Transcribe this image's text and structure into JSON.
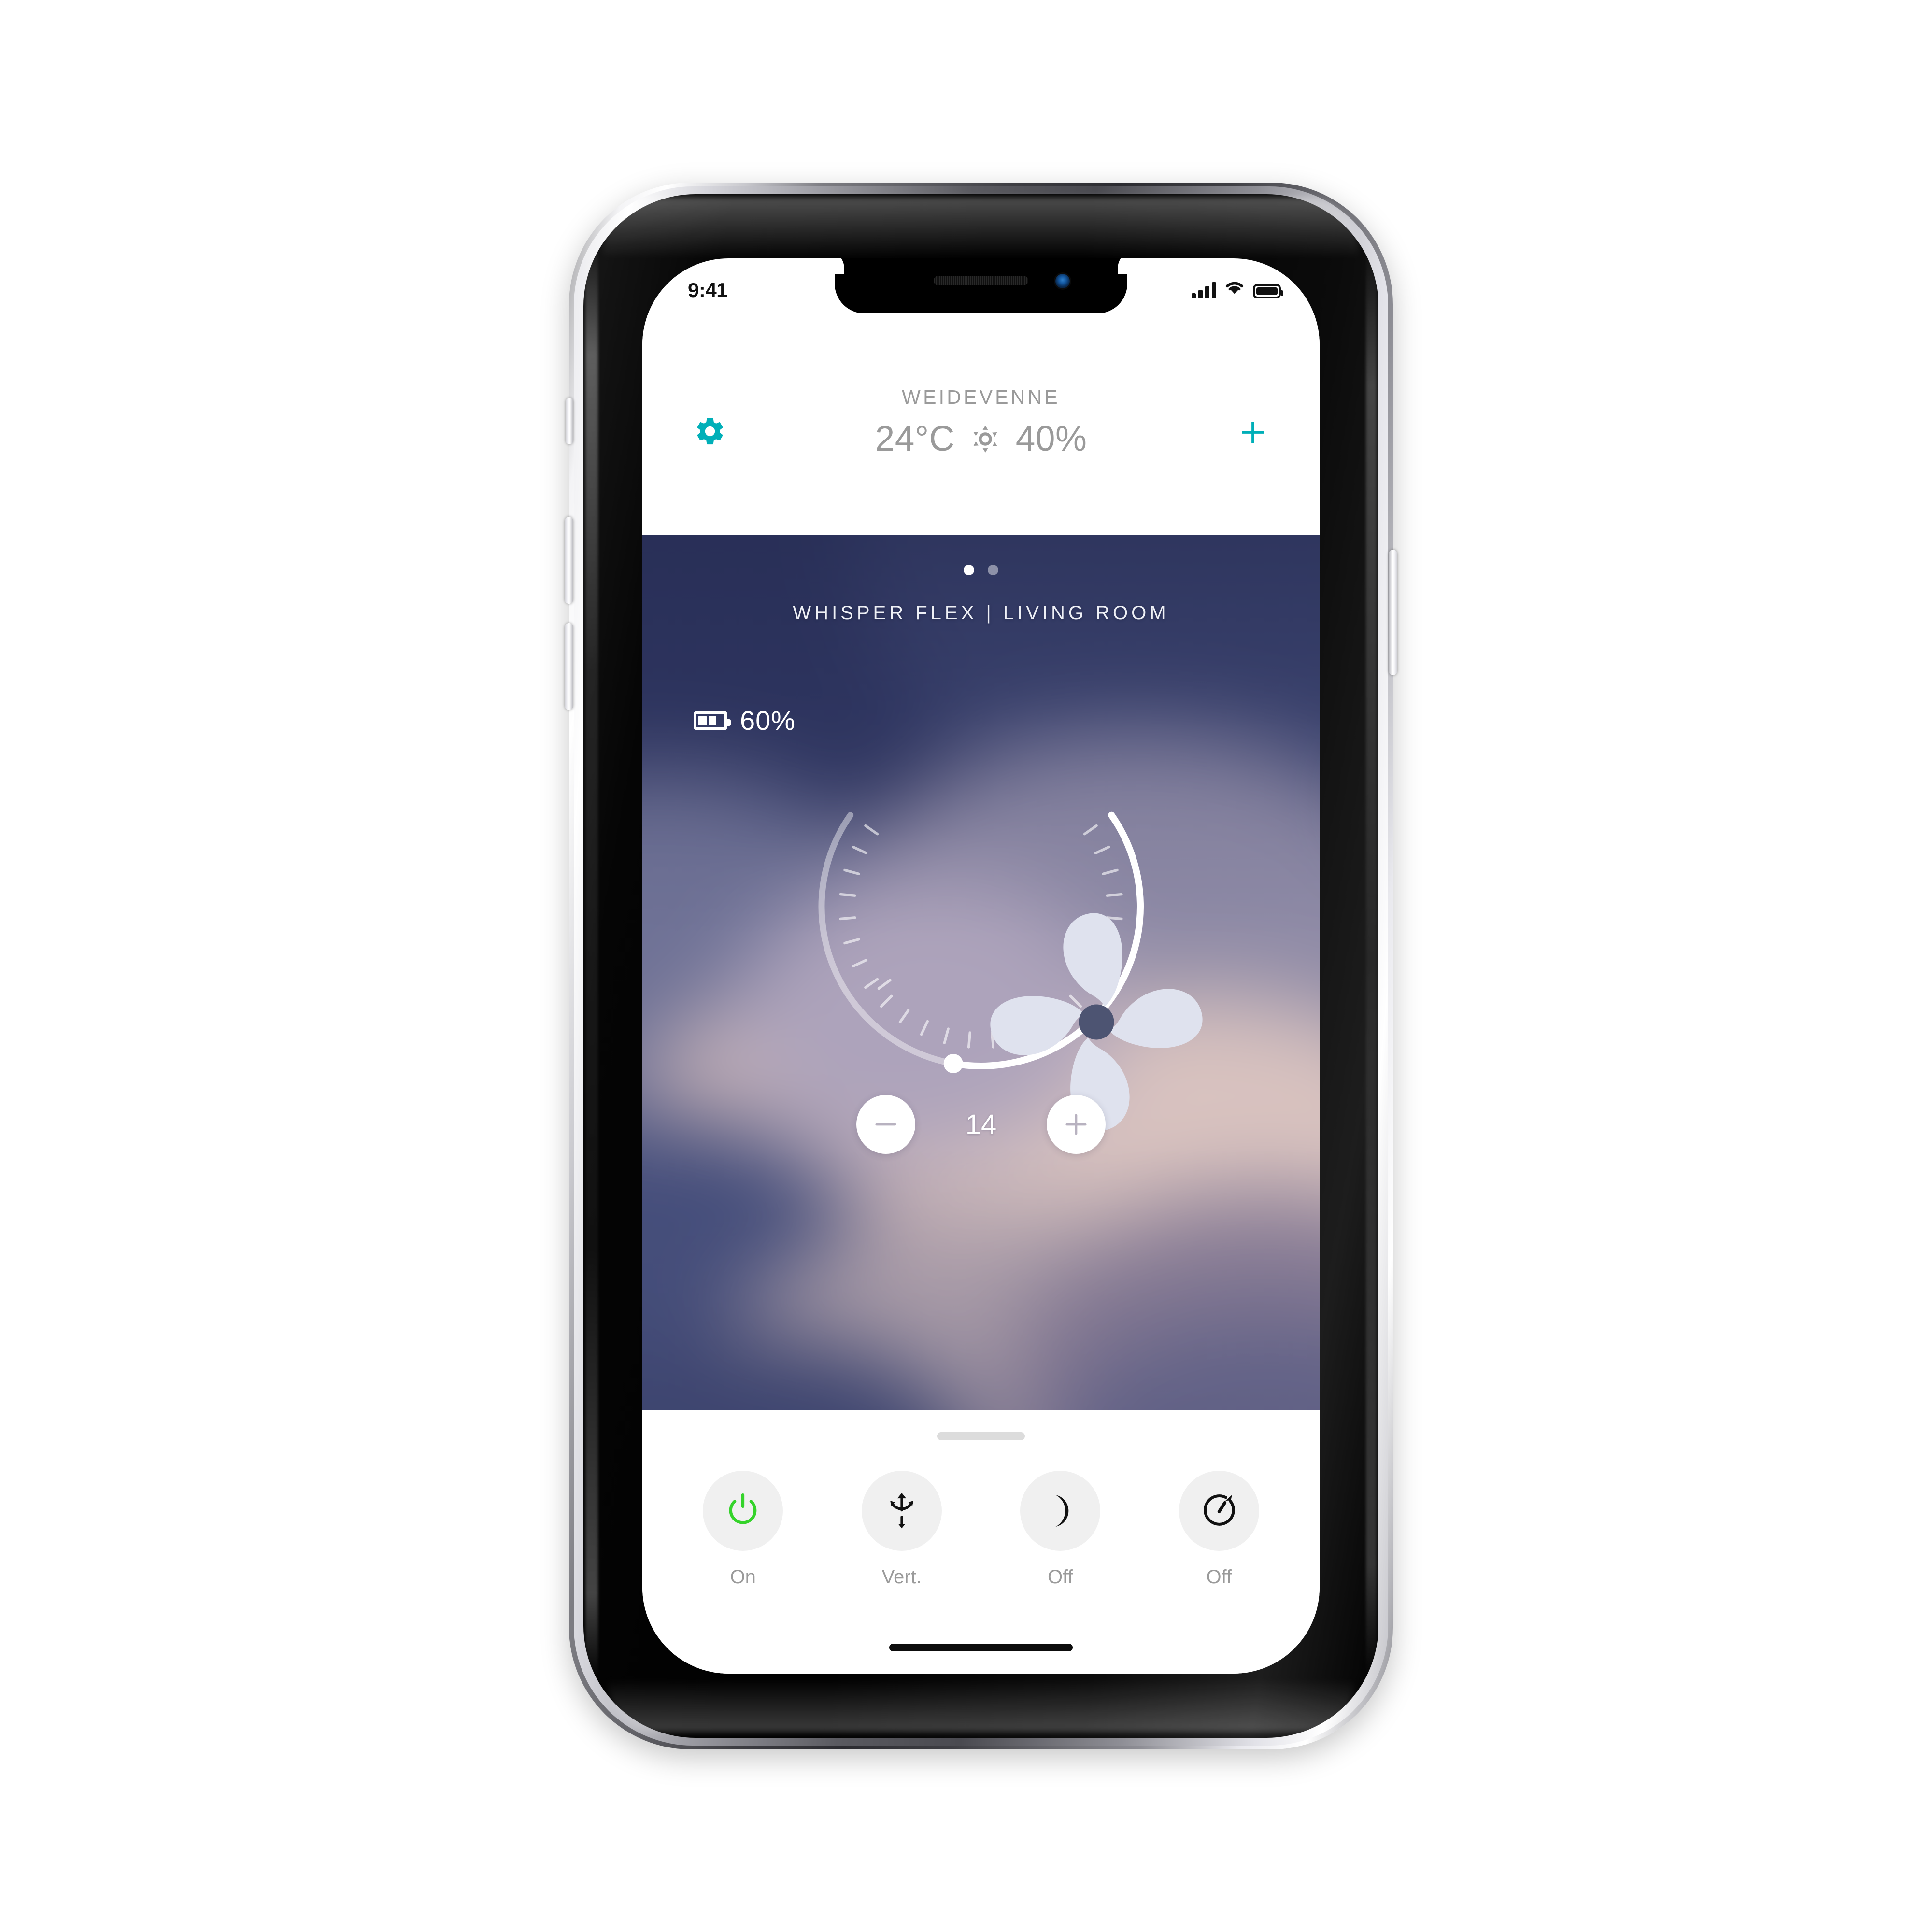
{
  "status_bar": {
    "time": "9:41",
    "signal_icon": "cellular-signal-icon",
    "wifi_icon": "wifi-icon",
    "battery_icon": "battery-full-icon"
  },
  "header": {
    "settings_icon": "gear-icon",
    "add_icon": "plus-icon",
    "site_name": "WEIDEVENNE",
    "temperature": "24°C",
    "brightness_icon": "sun-icon",
    "humidity": "40%",
    "accent_color": "#00AFB8"
  },
  "hero": {
    "pagination": {
      "count": 2,
      "active_index": 0
    },
    "device_title": "WHISPER FLEX | LIVING ROOM",
    "battery": {
      "icon": "battery-half-icon",
      "label": "60%"
    },
    "gauge": {
      "fan_icon": "fan-icon",
      "value": "14",
      "min": 1,
      "max": 26,
      "ticks": 26,
      "start_angle_deg": 145,
      "sweep_deg": 250,
      "active_fraction": 0.54,
      "active_color": "#ffffff",
      "track_color": "rgba(255,255,255,0.42)",
      "knob_color": "#ffffff"
    },
    "decrease": {
      "icon": "minus-icon",
      "label": "−"
    },
    "increase": {
      "icon": "plus-icon",
      "label": "+"
    }
  },
  "sheet": {
    "grab_handle": "drag-handle",
    "actions": [
      {
        "icon": "power-icon",
        "label": "On",
        "icon_color": "#35d32b",
        "name": "power"
      },
      {
        "icon": "vertical-swing-icon",
        "label": "Vert.",
        "icon_color": "#111111",
        "name": "swing"
      },
      {
        "icon": "moon-icon",
        "label": "Off",
        "icon_color": "#111111",
        "name": "night-mode"
      },
      {
        "icon": "timer-icon",
        "label": "Off",
        "icon_color": "#111111",
        "name": "timer"
      }
    ],
    "home_indicator": "home-indicator"
  }
}
